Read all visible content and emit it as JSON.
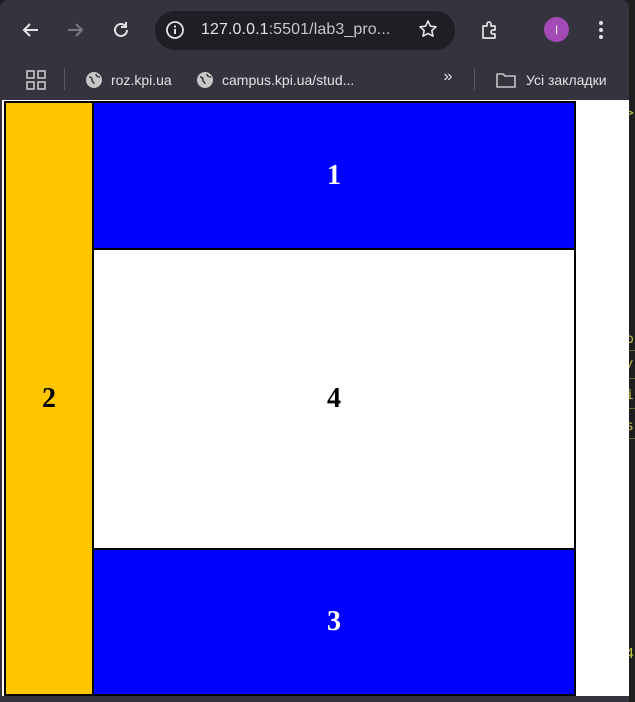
{
  "browser": {
    "url_host": "127.0.0.1",
    "url_rest": ":5501/lab3_pro...",
    "profile_initial": "I"
  },
  "bookmarks": {
    "items": [
      {
        "label": "roz.kpi.ua"
      },
      {
        "label": "campus.kpi.ua/stud..."
      }
    ],
    "all_bookmarks_label": "Усі закладки"
  },
  "layout_blocks": {
    "block1": {
      "label": "1",
      "color": "#0000ff",
      "text_color": "#ffffff"
    },
    "block2": {
      "label": "2",
      "color": "#ffc600",
      "text_color": "#000000"
    },
    "block3": {
      "label": "3",
      "color": "#0000ff",
      "text_color": "#ffffff"
    },
    "block4": {
      "label": "4",
      "color": "#ffffff",
      "text_color": "#000000"
    }
  },
  "editor_glyphs": [
    ">",
    "o",
    "/",
    "i",
    "s",
    "4"
  ],
  "colors": {
    "chrome_bg": "#35333d",
    "omnibox_bg": "#1f1e24",
    "avatar": "#a44ab7"
  }
}
